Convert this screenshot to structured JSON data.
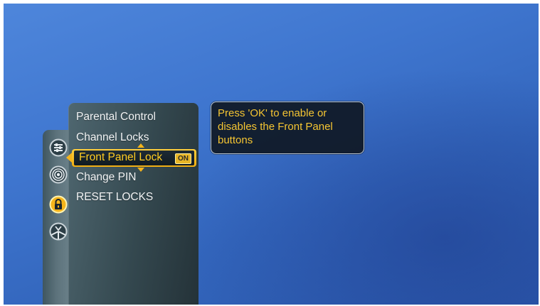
{
  "colors": {
    "accent": "#f5b41b",
    "highlight_text": "#ffcc22",
    "menu_text": "#f2f4f5",
    "help_text": "#f5c532"
  },
  "rail": {
    "icons": [
      {
        "name": "settings-sliders-icon",
        "active": false
      },
      {
        "name": "broadcast-signal-icon",
        "active": false
      },
      {
        "name": "lock-icon",
        "active": true
      },
      {
        "name": "satellite-dish-icon",
        "active": false
      }
    ]
  },
  "menu": {
    "items": [
      {
        "label": "Parental Control",
        "selected": false
      },
      {
        "label": "Channel Locks",
        "selected": false
      },
      {
        "label": "Front Panel Lock",
        "selected": true,
        "value": "ON"
      },
      {
        "label": "Change PIN",
        "selected": false
      },
      {
        "label": "RESET LOCKS",
        "selected": false
      }
    ]
  },
  "help": {
    "text": "Press 'OK' to enable or disables the Front Panel buttons"
  }
}
